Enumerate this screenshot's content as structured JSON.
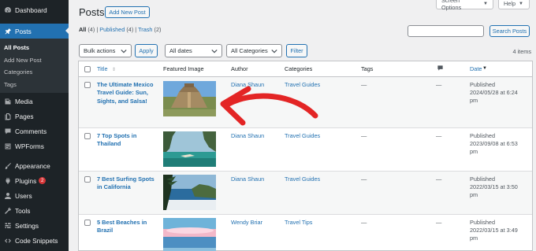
{
  "sidebar": {
    "items": [
      {
        "label": "Dashboard",
        "icon": "dashboard-icon"
      },
      {
        "label": "Posts",
        "icon": "pin-icon",
        "active": true
      },
      {
        "label": "Media",
        "icon": "media-icon"
      },
      {
        "label": "Pages",
        "icon": "pages-icon"
      },
      {
        "label": "Comments",
        "icon": "comment-icon"
      },
      {
        "label": "WPForms",
        "icon": "wpforms-icon"
      },
      {
        "label": "Appearance",
        "icon": "brush-icon"
      },
      {
        "label": "Plugins",
        "icon": "plugin-icon",
        "badge": "2"
      },
      {
        "label": "Users",
        "icon": "user-icon"
      },
      {
        "label": "Tools",
        "icon": "wrench-icon"
      },
      {
        "label": "Settings",
        "icon": "settings-icon"
      },
      {
        "label": "Code Snippets",
        "icon": "code-icon"
      }
    ],
    "posts_submenu": [
      "All Posts",
      "Add New Post",
      "Categories",
      "Tags"
    ]
  },
  "header": {
    "title": "Posts",
    "add_new": "Add New Post",
    "screen_options": "Screen Options",
    "help": "Help"
  },
  "filters": {
    "all": "All",
    "all_count": "(4)",
    "published": "Published",
    "published_count": "(4)",
    "trash": "Trash",
    "trash_count": "(2)",
    "search_value": "",
    "search_button": "Search Posts",
    "bulk_actions": "Bulk actions",
    "apply": "Apply",
    "all_dates": "All dates",
    "all_categories": "All Categories",
    "filter": "Filter",
    "items_count": "4 items"
  },
  "table": {
    "columns": {
      "title": "Title",
      "featured_image": "Featured Image",
      "author": "Author",
      "categories": "Categories",
      "tags": "Tags",
      "date": "Date"
    },
    "rows": [
      {
        "title_line1": "The Ultimate Mexico",
        "title_line2": "Travel Guide: Sun,",
        "title_line3": "Sights, and Salsa!",
        "image": "pyramid-photo",
        "author": "Diana Shaun",
        "category": "Travel Guides",
        "tags": "—",
        "comments": "—",
        "status": "Published",
        "date": "2024/05/28 at 6:24",
        "time_suffix": "pm"
      },
      {
        "title_line1": "7 Top Spots in",
        "title_line2": "Thailand",
        "title_line3": "",
        "image": "thailand-bay-photo",
        "author": "Diana Shaun",
        "category": "Travel Guides",
        "tags": "—",
        "comments": "—",
        "status": "Published",
        "date": "2023/09/08 at 6:53",
        "time_suffix": "pm"
      },
      {
        "title_line1": "7 Best Surfing Spots",
        "title_line2": "in California",
        "title_line3": "",
        "image": "california-coast-photo",
        "author": "Diana Shaun",
        "category": "Travel Guides",
        "tags": "—",
        "comments": "—",
        "status": "Published",
        "date": "2022/03/15 at 3:50",
        "time_suffix": "pm"
      },
      {
        "title_line1": "5 Best Beaches in",
        "title_line2": "Brazil",
        "title_line3": "",
        "image": "brazil-beach-photo",
        "author": "Wendy Briar",
        "category": "Travel Tips",
        "tags": "—",
        "comments": "—",
        "status": "Published",
        "date": "2022/03/15 at 3:49",
        "time_suffix": "pm"
      }
    ]
  },
  "colors": {
    "sidebar_bg": "#1d2327",
    "accent": "#2271b1",
    "annotation_arrow": "#e32525"
  }
}
